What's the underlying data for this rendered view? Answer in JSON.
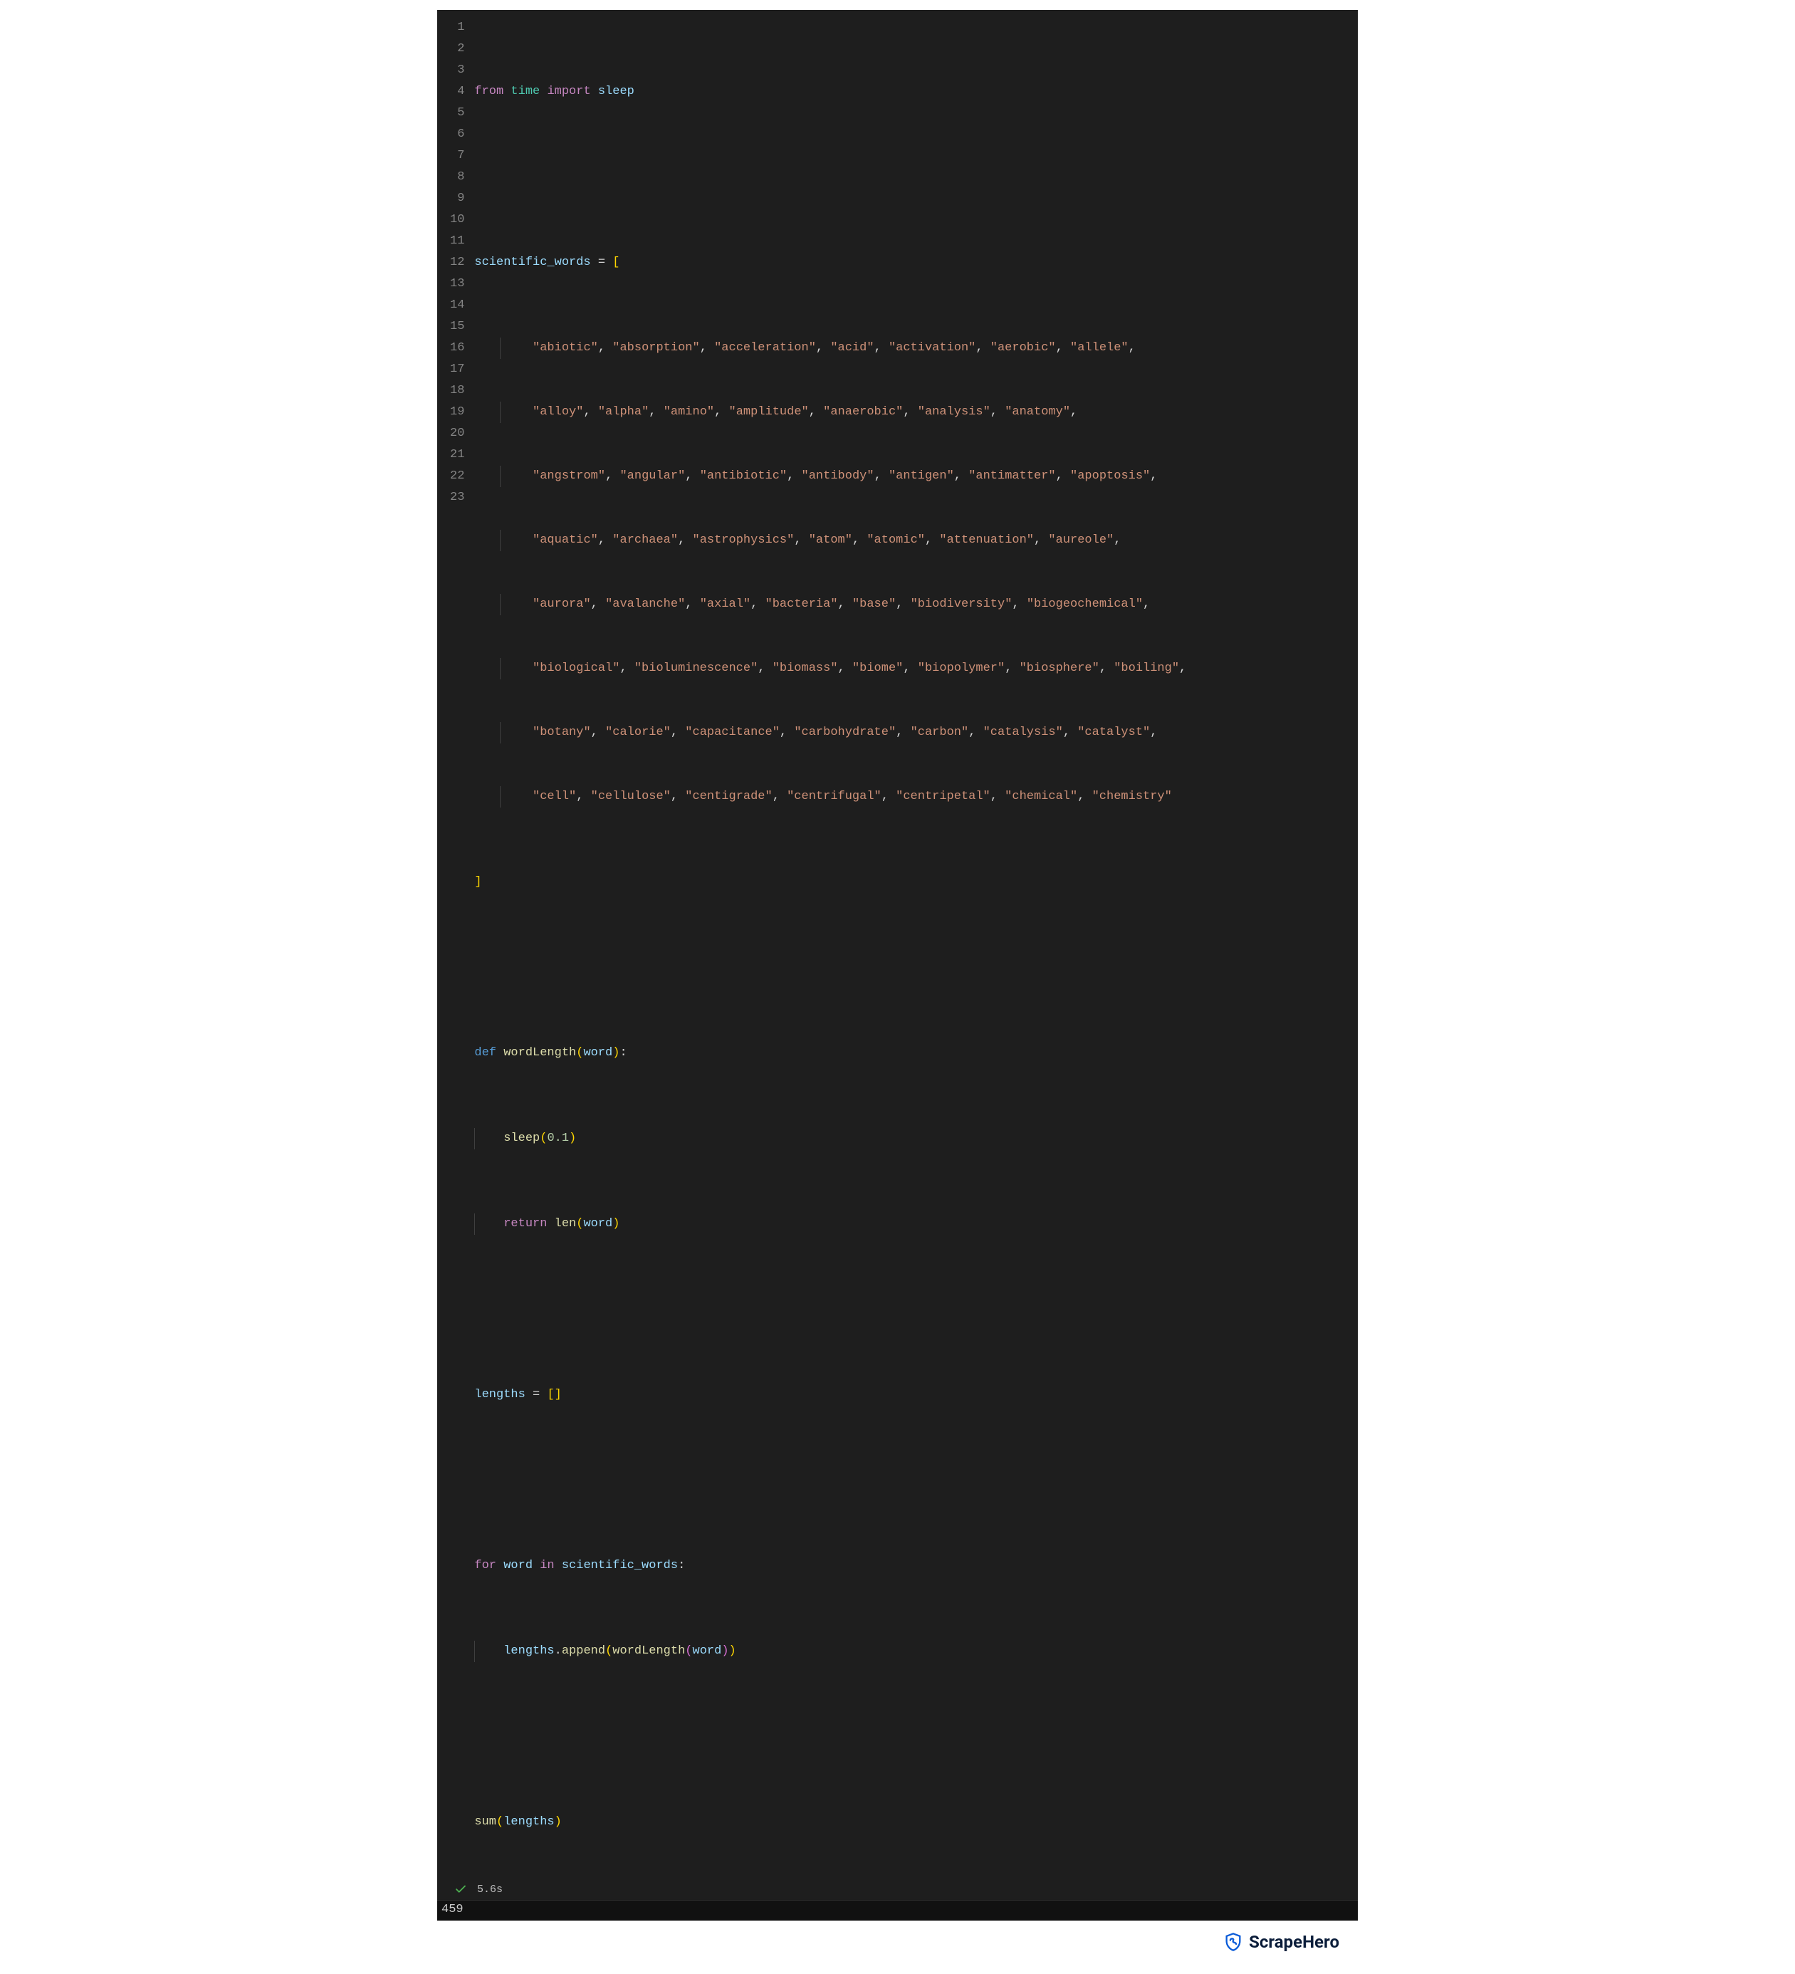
{
  "code": {
    "lines": 23,
    "line_numbers": [
      "1",
      "2",
      "3",
      "4",
      "5",
      "6",
      "7",
      "8",
      "9",
      "10",
      "11",
      "12",
      "13",
      "14",
      "15",
      "16",
      "17",
      "18",
      "19",
      "20",
      "21",
      "22",
      "23"
    ],
    "L1": {
      "kw_from": "from",
      "mod": "time",
      "kw_import": "import",
      "name": "sleep"
    },
    "L3": {
      "var": "scientific_words",
      "eq": " = ",
      "brk": "["
    },
    "L4": {
      "items": [
        "abiotic",
        "absorption",
        "acceleration",
        "acid",
        "activation",
        "aerobic",
        "allele"
      ]
    },
    "L5": {
      "items": [
        "alloy",
        "alpha",
        "amino",
        "amplitude",
        "anaerobic",
        "analysis",
        "anatomy"
      ]
    },
    "L6": {
      "items": [
        "angstrom",
        "angular",
        "antibiotic",
        "antibody",
        "antigen",
        "antimatter",
        "apoptosis"
      ]
    },
    "L7": {
      "items": [
        "aquatic",
        "archaea",
        "astrophysics",
        "atom",
        "atomic",
        "attenuation",
        "aureole"
      ]
    },
    "L8": {
      "items": [
        "aurora",
        "avalanche",
        "axial",
        "bacteria",
        "base",
        "biodiversity",
        "biogeochemical"
      ]
    },
    "L9": {
      "items": [
        "biological",
        "bioluminescence",
        "biomass",
        "biome",
        "biopolymer",
        "biosphere",
        "boiling"
      ]
    },
    "L10": {
      "items": [
        "botany",
        "calorie",
        "capacitance",
        "carbohydrate",
        "carbon",
        "catalysis",
        "catalyst"
      ]
    },
    "L11": {
      "items": [
        "cell",
        "cellulose",
        "centigrade",
        "centrifugal",
        "centripetal",
        "chemical",
        "chemistry"
      ]
    },
    "L12": {
      "brk": "]"
    },
    "L14": {
      "kw_def": "def",
      "fn": "wordLength",
      "param": "word"
    },
    "L15": {
      "fn": "sleep",
      "num": "0.1"
    },
    "L16": {
      "kw_ret": "return",
      "fn": "len",
      "arg": "word"
    },
    "L18": {
      "var": "lengths",
      "eq": " = ",
      "brk_open": "[",
      "brk_close": "]"
    },
    "L20": {
      "kw_for": "for",
      "var": "word",
      "kw_in": "in",
      "iter": "scientific_words"
    },
    "L21": {
      "obj": "lengths",
      "meth": "append",
      "fn": "wordLength",
      "arg": "word"
    },
    "L23": {
      "fn": "sum",
      "arg": "lengths"
    }
  },
  "status": {
    "icon": "check-icon",
    "time": "5.6s"
  },
  "output": {
    "value": "459"
  },
  "watermark": {
    "brand": "ScrapeHero"
  }
}
